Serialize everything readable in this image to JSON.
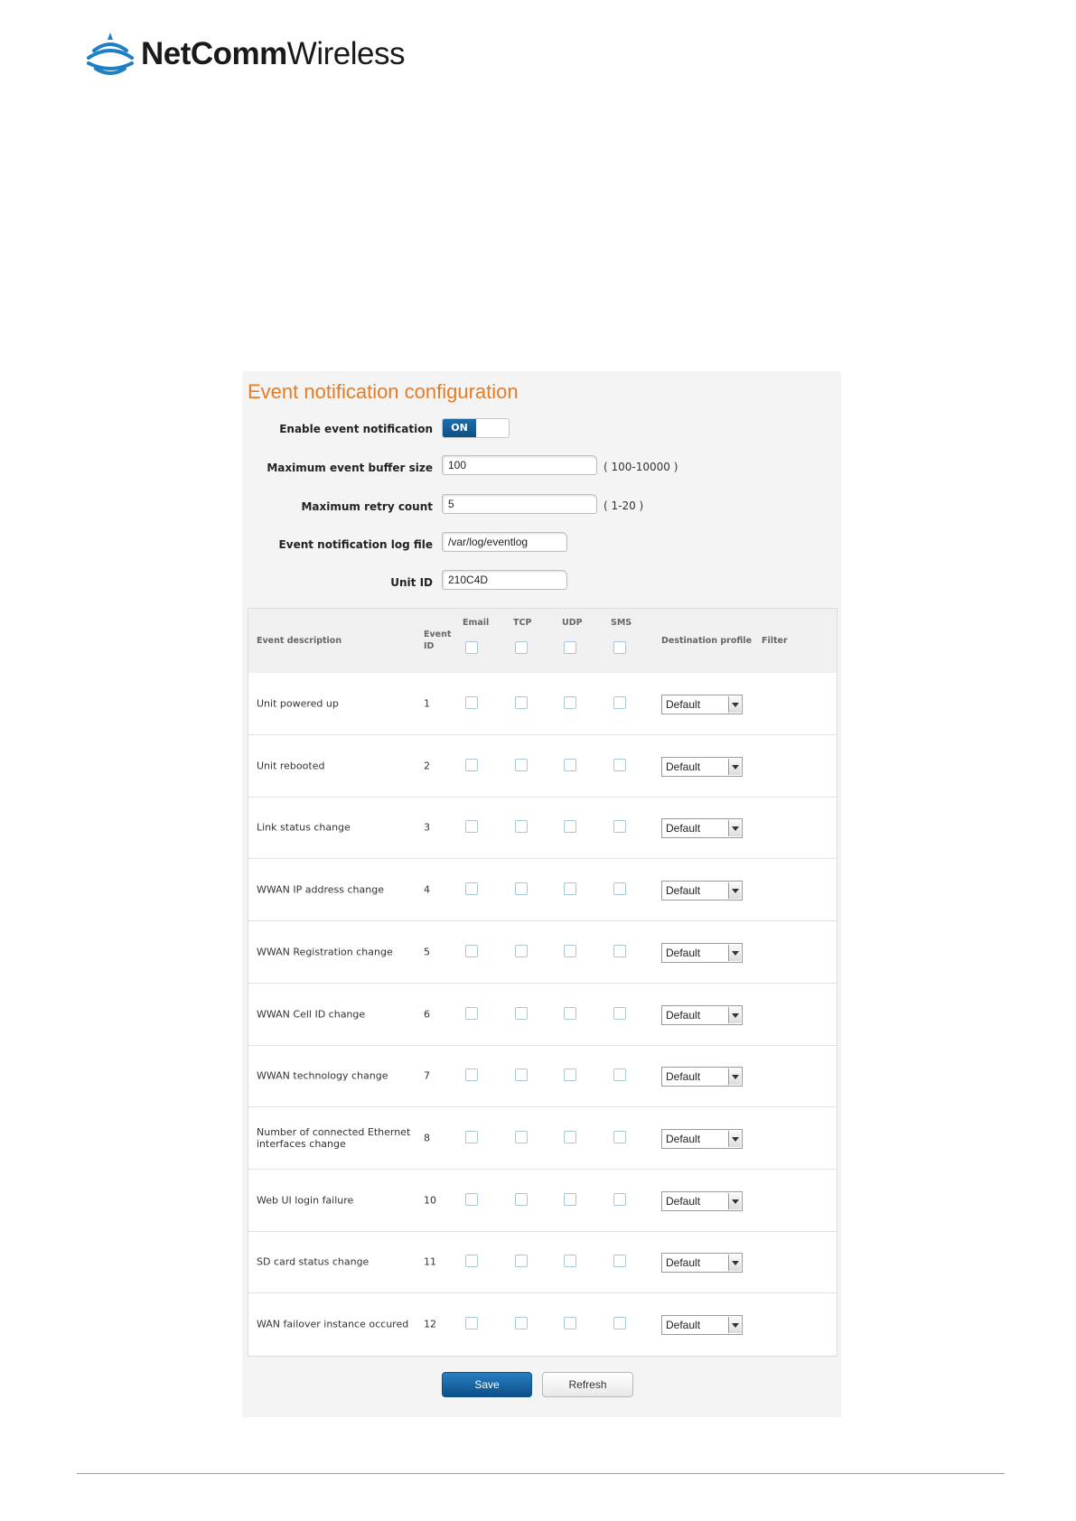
{
  "logo": {
    "brand_bold": "NetComm",
    "brand_light": "Wireless"
  },
  "panel": {
    "title": "Event notification configuration",
    "fields": {
      "enable_label": "Enable event notification",
      "enable_state": "ON",
      "buffer_label": "Maximum event buffer size",
      "buffer_value": "100",
      "buffer_hint": "( 100-10000 )",
      "retry_label": "Maximum retry count",
      "retry_value": "5",
      "retry_hint": "( 1-20 )",
      "logfile_label": "Event notification log file",
      "logfile_value": "/var/log/eventlog",
      "unitid_label": "Unit ID",
      "unitid_value": "210C4D"
    },
    "table": {
      "headers": {
        "description": "Event description",
        "event_id": "Event ID",
        "email": "Email",
        "tcp": "TCP",
        "udp": "UDP",
        "sms": "SMS",
        "destination": "Destination profile",
        "filter": "Filter"
      },
      "rows": [
        {
          "description": "Unit powered up",
          "id": "1",
          "profile": "Default"
        },
        {
          "description": "Unit rebooted",
          "id": "2",
          "profile": "Default"
        },
        {
          "description": "Link status change",
          "id": "3",
          "profile": "Default"
        },
        {
          "description": "WWAN IP address change",
          "id": "4",
          "profile": "Default"
        },
        {
          "description": "WWAN Registration change",
          "id": "5",
          "profile": "Default"
        },
        {
          "description": "WWAN Cell ID change",
          "id": "6",
          "profile": "Default"
        },
        {
          "description": "WWAN technology change",
          "id": "7",
          "profile": "Default"
        },
        {
          "description": "Number of connected Ethernet interfaces change",
          "id": "8",
          "profile": "Default"
        },
        {
          "description": "Web UI login failure",
          "id": "10",
          "profile": "Default"
        },
        {
          "description": "SD card status change",
          "id": "11",
          "profile": "Default"
        },
        {
          "description": "WAN failover instance occured",
          "id": "12",
          "profile": "Default"
        }
      ]
    },
    "buttons": {
      "save": "Save",
      "refresh": "Refresh"
    }
  },
  "colors": {
    "title": "#e57c25",
    "primary_button": "#0c4f8a",
    "toggle_on": "#1f6da8"
  }
}
